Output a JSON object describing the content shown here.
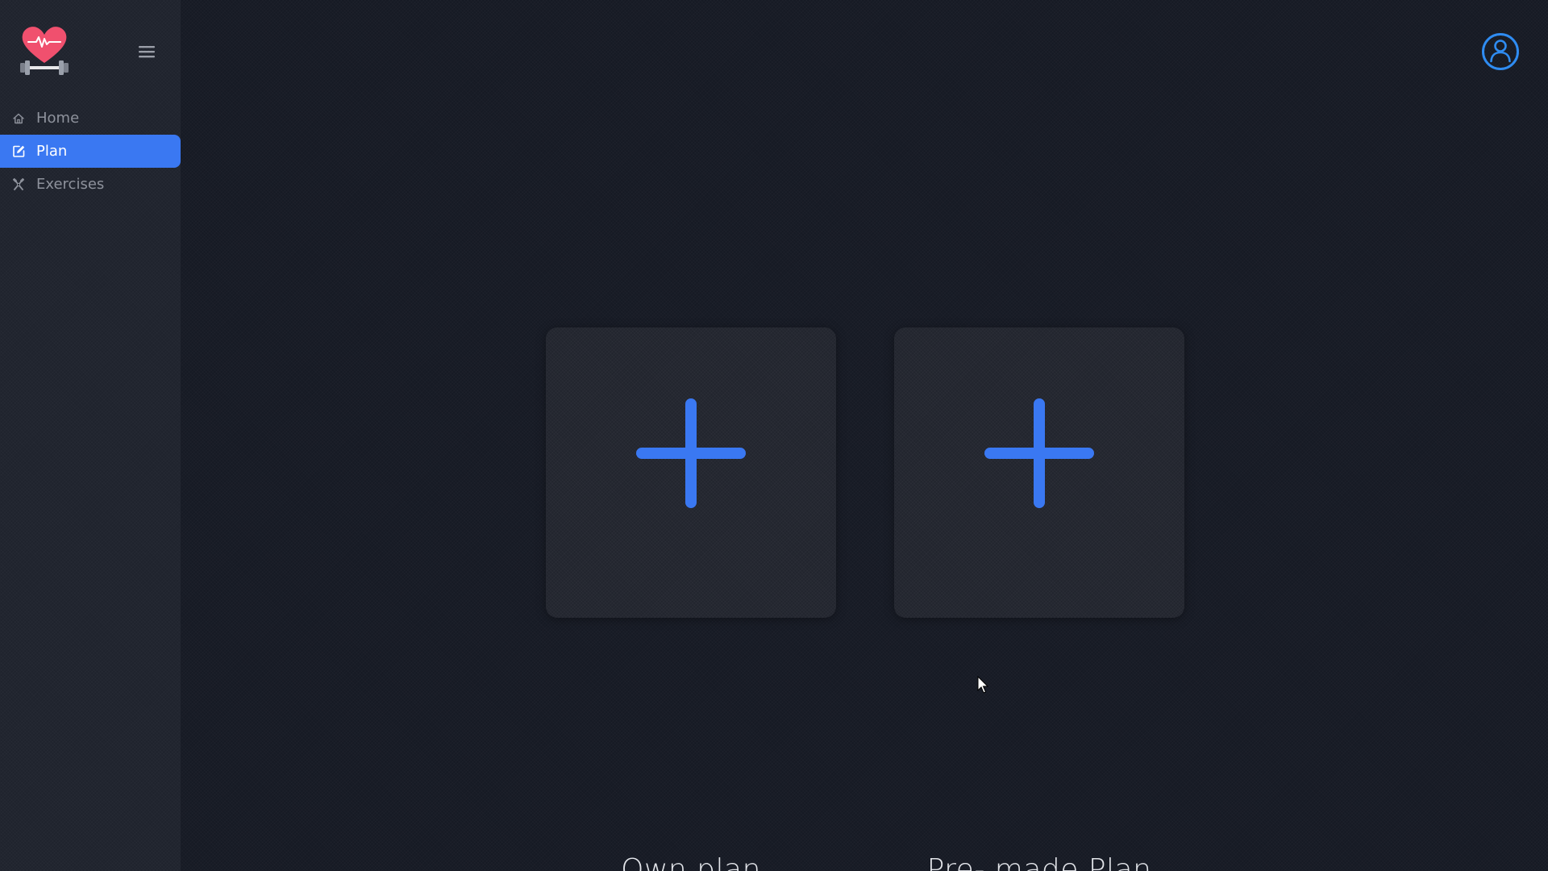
{
  "sidebar": {
    "items": [
      {
        "label": "Home",
        "icon": "home-icon"
      },
      {
        "label": "Plan",
        "icon": "edit-icon",
        "active": true
      },
      {
        "label": "Exercises",
        "icon": "exercise-icon"
      }
    ]
  },
  "cards": [
    {
      "label": "Own plan",
      "icon": "plus-icon"
    },
    {
      "label": "Pre- made Plan",
      "icon": "plus-icon"
    }
  ],
  "colors": {
    "accent": "#3a78f2",
    "logo_heart": "#f0506e",
    "user_icon": "#2f8cf2"
  }
}
